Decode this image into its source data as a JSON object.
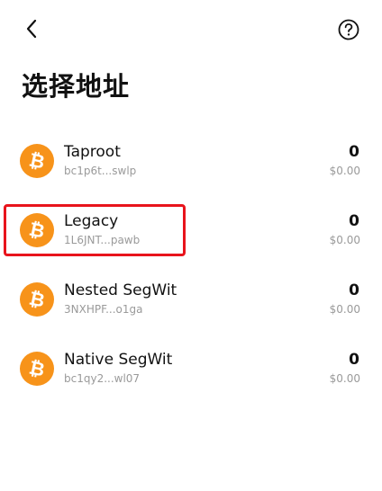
{
  "header": {
    "back_icon": "chevron-left-icon",
    "help_icon": "question-circle-icon"
  },
  "page_title": "选择地址",
  "addresses": [
    {
      "name": "Taproot",
      "short": "bc1p6t...swlp",
      "balance": "0",
      "fiat": "$0.00",
      "icon": "bitcoin-icon"
    },
    {
      "name": "Legacy",
      "short": "1L6JNT...pawb",
      "balance": "0",
      "fiat": "$0.00",
      "icon": "bitcoin-icon",
      "highlighted": true
    },
    {
      "name": "Nested SegWit",
      "short": "3NXHPF...o1ga",
      "balance": "0",
      "fiat": "$0.00",
      "icon": "bitcoin-icon"
    },
    {
      "name": "Native SegWit",
      "short": "bc1qy2...wl07",
      "balance": "0",
      "fiat": "$0.00",
      "icon": "bitcoin-icon"
    }
  ],
  "colors": {
    "bitcoin_orange": "#f7931a",
    "highlight_red": "#e8141c",
    "secondary_text": "#9a9a9a"
  }
}
